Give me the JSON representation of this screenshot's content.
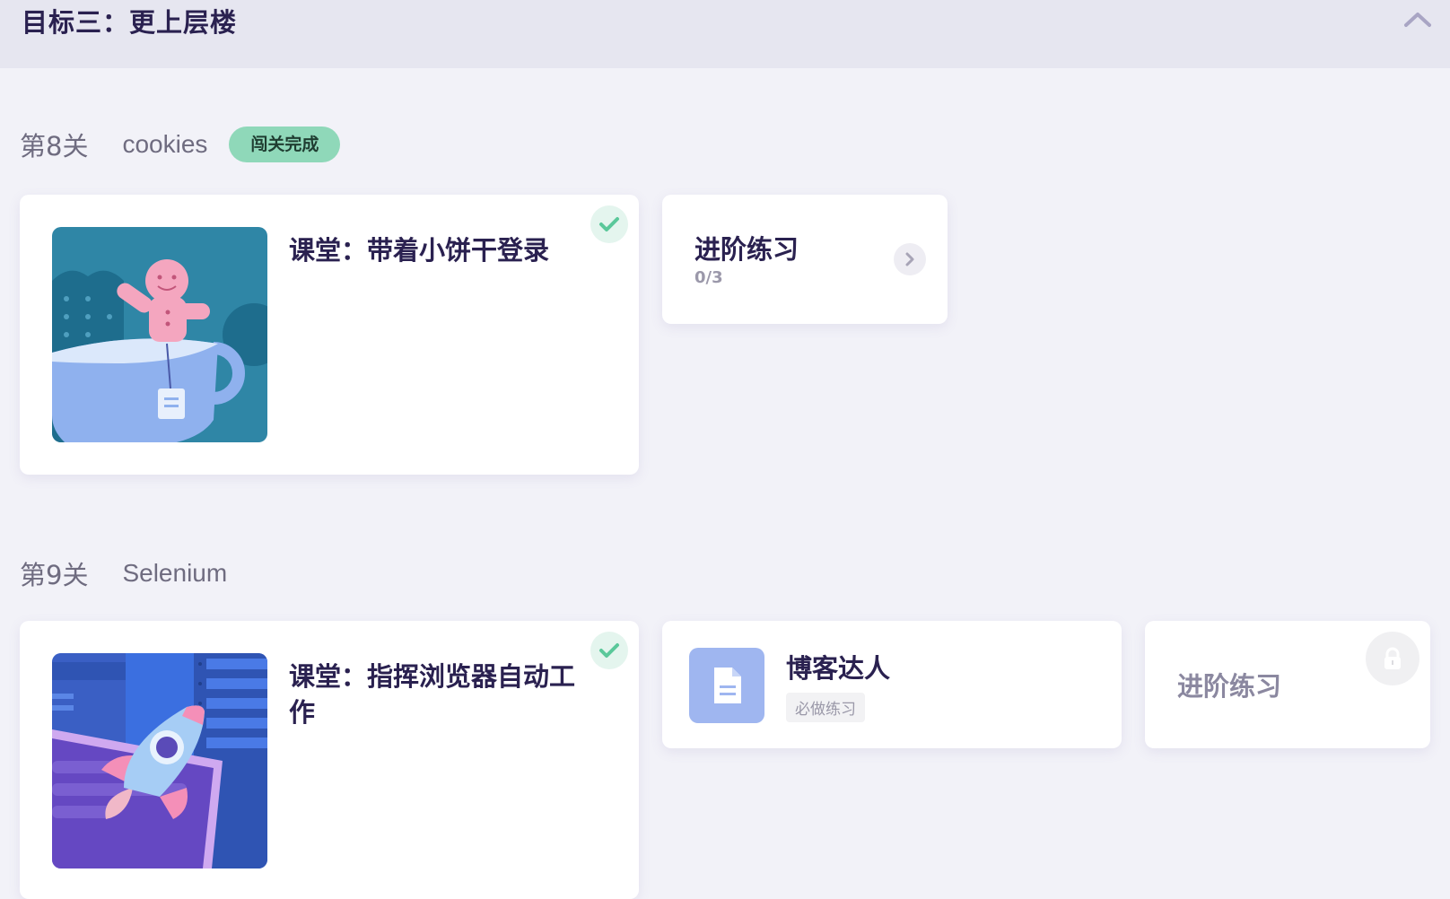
{
  "goal": {
    "title": "目标三：更上层楼"
  },
  "levels": [
    {
      "number": "第8关",
      "name": "cookies",
      "badge": "闯关完成",
      "lesson": {
        "title": "课堂：带着小饼干登录"
      },
      "practice": {
        "title": "进阶练习",
        "progress": "0/3"
      }
    },
    {
      "number": "第9关",
      "name": "Selenium",
      "lesson": {
        "title": "课堂：指挥浏览器自动工作"
      },
      "exercise": {
        "title": "博客达人",
        "tag": "必做练习"
      },
      "advanced": {
        "title": "进阶练习"
      }
    }
  ],
  "colors": {
    "accent_green": "#5ac89a",
    "badge_green": "#8fd8b9",
    "doc_blue": "#9fb6f0"
  },
  "icons": [
    "chevron-up-icon",
    "check-icon",
    "chevron-right-icon",
    "document-icon",
    "lock-icon"
  ]
}
